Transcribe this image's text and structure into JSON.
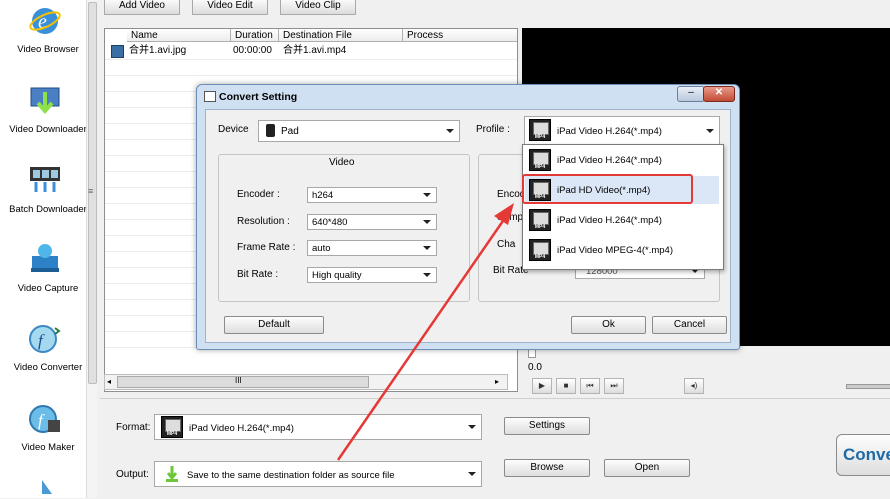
{
  "sidebar": {
    "items": [
      {
        "label": "Video Browser",
        "icon": "globe-ie-icon"
      },
      {
        "label": "Video Downloader",
        "icon": "download-icon"
      },
      {
        "label": "Batch Downloader",
        "icon": "film-download-icon"
      },
      {
        "label": "Video Capture",
        "icon": "camera-icon"
      },
      {
        "label": "Video Converter",
        "icon": "converter-icon"
      },
      {
        "label": "Video Maker",
        "icon": "video-maker-icon"
      }
    ]
  },
  "tabs": [
    "Add Video",
    "Video Edit",
    "Video Clip"
  ],
  "table": {
    "columns": [
      "Name",
      "Duration",
      "Destination File",
      "Process"
    ],
    "rows": [
      {
        "name": "合并1.avi.jpg",
        "duration": "00:00:00",
        "destination": "合并1.avi.mp4",
        "process": ""
      }
    ],
    "hscroll_glyph": "III"
  },
  "preview": {
    "time": "0.0"
  },
  "dialog": {
    "title": "Convert Setting",
    "device_label": "Device",
    "device_value": "Pad",
    "profile_label": "Profile :",
    "profile_value": "iPad Video H.264(*.mp4)",
    "video_group": "Video",
    "fields": {
      "encoder_label": "Encoder :",
      "encoder_value": "h264",
      "resolution_label": "Resolution :",
      "resolution_value": "640*480",
      "framerate_label": "Frame Rate :",
      "framerate_value": "auto",
      "bitrate_label": "Bit Rate :",
      "bitrate_value": "High quality"
    },
    "audio_partial": {
      "encoder": "Encod",
      "sample": "Sampl",
      "channel": "Cha",
      "bitrate": "Bit Rate",
      "bitrate_value": "128000"
    },
    "buttons": {
      "default": "Default",
      "ok": "Ok",
      "cancel": "Cancel"
    },
    "profile_options": [
      "iPad Video H.264(*.mp4)",
      "iPad HD Video(*.mp4)",
      "iPad Video H.264(*.mp4)",
      "iPad Video MPEG-4(*.mp4)"
    ],
    "highlighted_option": "iPad HD Video(*.mp4)"
  },
  "bottom": {
    "format_label": "Format:",
    "format_value": "iPad Video H.264(*.mp4)",
    "output_label": "Output:",
    "output_value": "Save to the same destination folder as source file",
    "settings_button": "Settings",
    "browse_button": "Browse",
    "open_button": "Open",
    "convert_button": "Conve"
  },
  "annotation_color": "#e53935"
}
